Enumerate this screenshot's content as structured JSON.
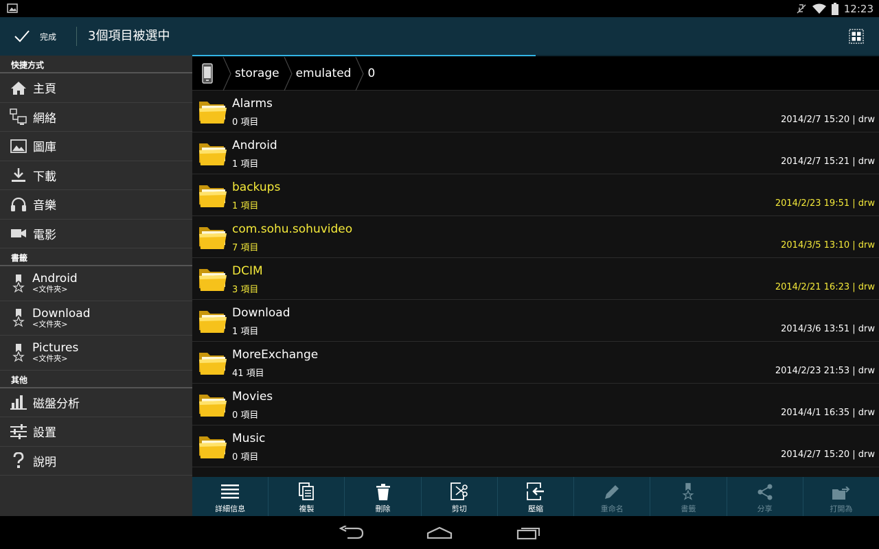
{
  "status_bar": {
    "time": "12:23"
  },
  "action_bar": {
    "done_label": "完成",
    "title": "3個項目被選中"
  },
  "progress": 0.5,
  "sidebar": {
    "sections": [
      {
        "header": "快捷方式"
      },
      {
        "header": "書籤"
      },
      {
        "header": "其他"
      }
    ],
    "shortcuts": [
      {
        "label": "主頁",
        "icon": "home-icon"
      },
      {
        "label": "網絡",
        "icon": "network-icon"
      },
      {
        "label": "圖庫",
        "icon": "gallery-icon"
      },
      {
        "label": "下載",
        "icon": "download-icon"
      },
      {
        "label": "音樂",
        "icon": "headphones-icon"
      },
      {
        "label": "電影",
        "icon": "video-camera-icon"
      }
    ],
    "bookmarks": [
      {
        "label": "Android",
        "sub": "<文件夾>"
      },
      {
        "label": "Download",
        "sub": "<文件夾>"
      },
      {
        "label": "Pictures",
        "sub": "<文件夾>"
      }
    ],
    "others": [
      {
        "label": "磁盤分析",
        "icon": "bar-chart-icon"
      },
      {
        "label": "設置",
        "icon": "sliders-icon"
      },
      {
        "label": "說明",
        "icon": "question-icon"
      }
    ]
  },
  "breadcrumb": [
    "storage",
    "emulated",
    "0"
  ],
  "files": [
    {
      "name": "Alarms",
      "count": "0 項目",
      "meta": "2014/2/7 15:20 | drw",
      "selected": false
    },
    {
      "name": "Android",
      "count": "1 項目",
      "meta": "2014/2/7 15:21 | drw",
      "selected": false
    },
    {
      "name": "backups",
      "count": "1 項目",
      "meta": "2014/2/23 19:51 | drw",
      "selected": true
    },
    {
      "name": "com.sohu.sohuvideo",
      "count": "7 項目",
      "meta": "2014/3/5 13:10 | drw",
      "selected": true
    },
    {
      "name": "DCIM",
      "count": "3 項目",
      "meta": "2014/2/21 16:23 | drw",
      "selected": true
    },
    {
      "name": "Download",
      "count": "1 項目",
      "meta": "2014/3/6 13:51 | drw",
      "selected": false
    },
    {
      "name": "MoreExchange",
      "count": "41 項目",
      "meta": "2014/2/23 21:53 | drw",
      "selected": false
    },
    {
      "name": "Movies",
      "count": "0 項目",
      "meta": "2014/4/1 16:35 | drw",
      "selected": false
    },
    {
      "name": "Music",
      "count": "0 項目",
      "meta": "2014/2/7 15:20 | drw",
      "selected": false
    },
    {
      "name": "",
      "count": "",
      "meta": "",
      "selected": false
    }
  ],
  "toolbar": [
    {
      "label": "詳細信息",
      "icon": "details-icon",
      "enabled": true
    },
    {
      "label": "複製",
      "icon": "copy-icon",
      "enabled": true
    },
    {
      "label": "刪除",
      "icon": "trash-icon",
      "enabled": true
    },
    {
      "label": "剪切",
      "icon": "cut-icon",
      "enabled": true
    },
    {
      "label": "壓縮",
      "icon": "compress-icon",
      "enabled": true
    },
    {
      "label": "重命名",
      "icon": "pencil-icon",
      "enabled": false
    },
    {
      "label": "書籤",
      "icon": "bookmark-icon",
      "enabled": false
    },
    {
      "label": "分享",
      "icon": "share-icon",
      "enabled": false
    },
    {
      "label": "打開為",
      "icon": "open-as-icon",
      "enabled": false
    }
  ],
  "colors": {
    "accent": "#33b5e5",
    "selected_text": "#f5ea3a",
    "action_bar": "#10303f",
    "toolbar": "#0d3444"
  }
}
